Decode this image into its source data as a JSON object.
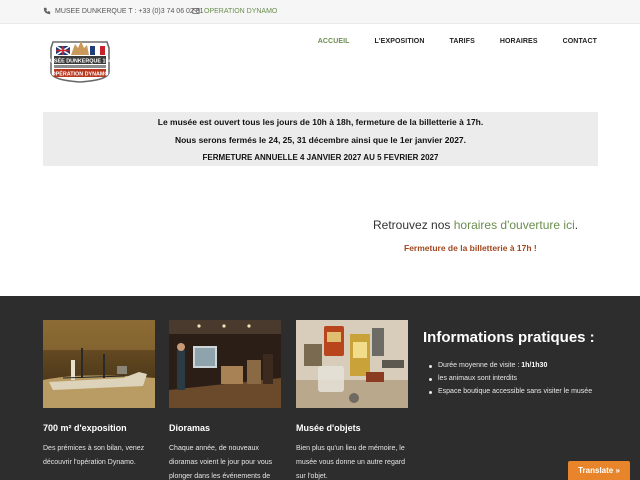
{
  "topbar": {
    "phone": "MUSEE DUNKERQUE T : +33 (0)3 74 06 02 81",
    "email": "OPERATION DYNAMO"
  },
  "logo": {
    "line1": "MUSÉE DUNKERQUE 1940",
    "line2": "OPÉRATION DYNAMO"
  },
  "nav": {
    "items": [
      "ACCUEIL",
      "L'EXPOSITION",
      "TARIFS",
      "HORAIRES",
      "CONTACT"
    ],
    "active": "ACCUEIL"
  },
  "notice": {
    "line1": "Le musée est ouvert tous les jours de 10h à 18h, fermeture de la billetterie à 17h.",
    "line2": "Nous serons fermés le 24, 25, 31 décembre ainsi que le 1er janvier 2027.",
    "line3": "FERMETURE ANNUELLE 4 JANVIER 2027 AU 5 FEVRIER 2027"
  },
  "hours": {
    "prefix": "Retrouvez nos ",
    "link": "horaires d'ouverture ici",
    "suffix": ".",
    "closing": "Fermeture de la billetterie à 17h !"
  },
  "cards": [
    {
      "title": "700 m² d'exposition",
      "desc": "Des prémices à son bilan, venez découvrir l'opération Dynamo."
    },
    {
      "title": "Dioramas",
      "desc": "Chaque année, de nouveaux dioramas voient le jour pour vous plonger dans les événements de"
    },
    {
      "title": "Musée d'objets",
      "desc": "Bien plus qu'un lieu de mémoire, le musée vous donne un autre regard sur l'objet."
    }
  ],
  "info": {
    "title": "Informations pratiques :",
    "items": [
      {
        "label": "Durée moyenne de visite : ",
        "value": "1h/1h30"
      },
      {
        "label": "les animaux sont interdits",
        "value": ""
      },
      {
        "label": "Espace boutique accessible sans visiter le musée",
        "value": ""
      }
    ]
  },
  "translate": {
    "label": "Translate »"
  },
  "colors": {
    "accent": "#6b8e4e",
    "alert": "#a0471e",
    "dark_bg": "#2d2d2d",
    "translate_bg": "#e8852b"
  }
}
